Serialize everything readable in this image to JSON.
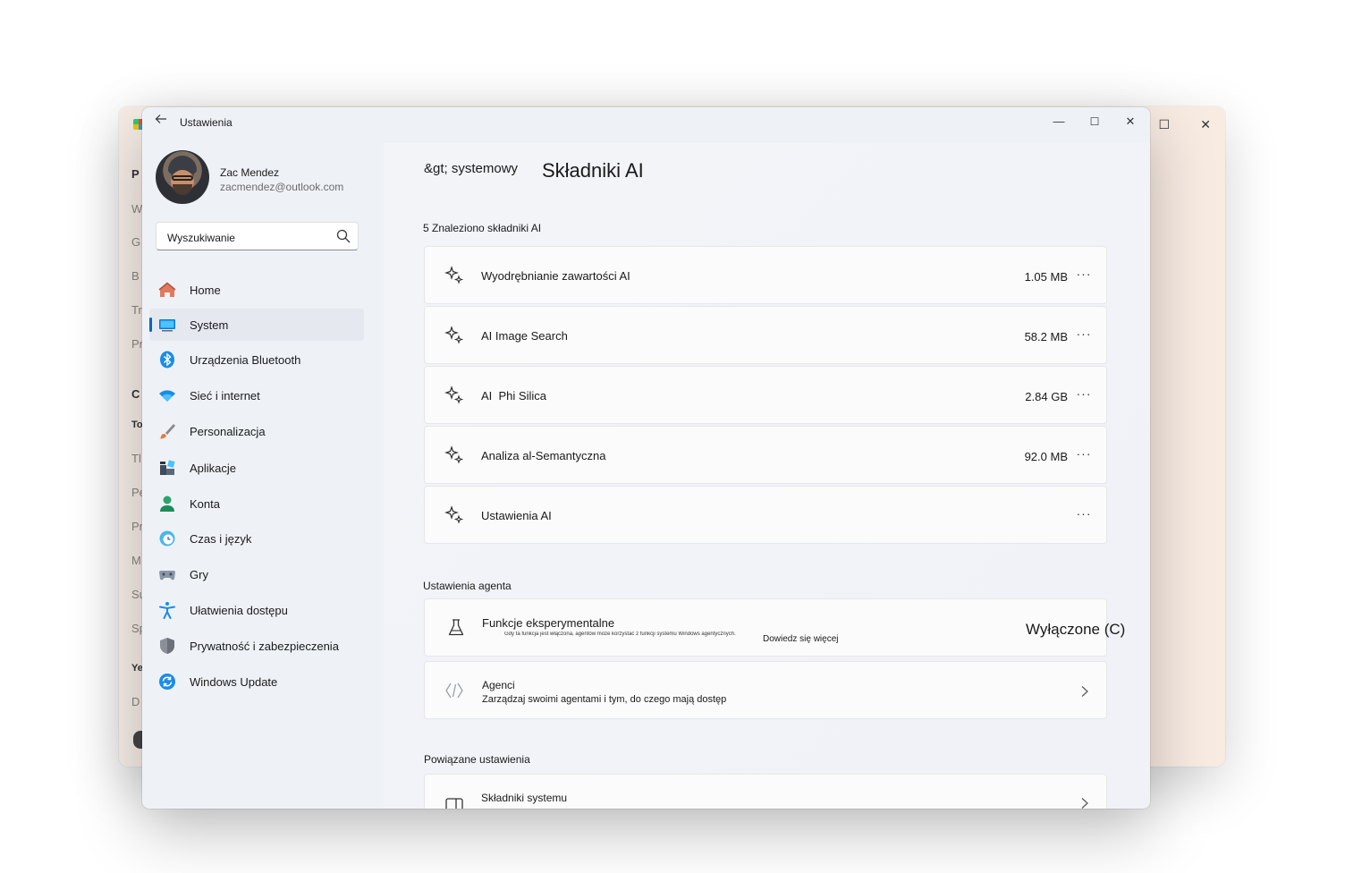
{
  "background_window": {
    "left_letters": [
      "P",
      "W",
      "G",
      "B",
      "Tr",
      "Pr",
      "C",
      "To",
      "Tl",
      "Pe",
      "Pr",
      "M",
      "Su",
      "Sp",
      "Ye",
      "D"
    ]
  },
  "window": {
    "title": "Ustawienia",
    "controls": {
      "minimize": "—",
      "maximize": "☐",
      "close": "✕"
    }
  },
  "profile": {
    "name": "Zac Mendez",
    "email": "zacmendez@outlook.com"
  },
  "search": {
    "placeholder": "Wyszukiwanie"
  },
  "nav": [
    {
      "label": "Home",
      "icon": "home-icon"
    },
    {
      "label": "System",
      "icon": "system-icon",
      "active": true
    },
    {
      "label": "Urządzenia Bluetooth",
      "icon": "bluetooth-icon"
    },
    {
      "label": "Sieć i internet",
      "icon": "wifi-icon"
    },
    {
      "label": "Personalizacja",
      "icon": "brush-icon"
    },
    {
      "label": "Aplikacje",
      "icon": "apps-icon"
    },
    {
      "label": "Konta",
      "icon": "account-icon"
    },
    {
      "label": "Czas i język",
      "icon": "clock-globe-icon"
    },
    {
      "label": "Gry",
      "icon": "gamepad-icon"
    },
    {
      "label": "Ułatwienia dostępu",
      "icon": "accessibility-icon"
    },
    {
      "label": "Prywatność i zabezpieczenia",
      "icon": "shield-icon"
    },
    {
      "label": "Windows Update",
      "icon": "update-icon"
    }
  ],
  "header": {
    "parent": "&gt; systemowy",
    "current": "Składniki AI"
  },
  "components": {
    "section_title": "5 Znaleziono składniki AI",
    "items": [
      {
        "label": "Wyodrębnianie zawartości AI",
        "size": "1.05 MB",
        "more": "···"
      },
      {
        "label": "AI Image Search",
        "size": "58.2 MB",
        "more": "···"
      },
      {
        "label": "AI  Phi Silica",
        "size": "2.84 GB",
        "more": "···"
      },
      {
        "label": "Analiza al-Semantyczna",
        "size": "92.0 MB",
        "more": "···"
      },
      {
        "label": "Ustawienia AI",
        "size": "",
        "more": "···"
      }
    ]
  },
  "agent_settings": {
    "section_title": "Ustawienia agenta",
    "experimental": {
      "title": "Funkcje eksperymentalne",
      "description": "Gdy ta funkcja jest włączona, agentów może korzystać z funkcji systemu Windows agentycznych.",
      "learn_more": "Dowiedz się więcej",
      "toggle_label": "Wyłączone (C)"
    },
    "agents": {
      "title": "Agenci",
      "subtitle": "Zarządzaj swoimi agentami i tym, do czego mają dostęp"
    }
  },
  "related": {
    "section_title": "Powiązane ustawienia",
    "items": [
      {
        "title": "Składniki systemu"
      }
    ]
  },
  "colors": {
    "accent": "#0067c0",
    "active_nav_bg": "#e5e8ee",
    "card_bg": "#fbfbfc"
  }
}
